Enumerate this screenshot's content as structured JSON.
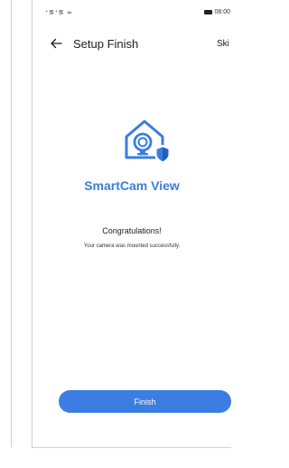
{
  "status_bar": {
    "signal": "⁺⪚⁺⪚ ≈",
    "time": "08:00"
  },
  "header": {
    "back_icon": "arrow-left-icon",
    "title": "Setup Finish",
    "skip_label": "Ski"
  },
  "brand": {
    "logo_icon": "home-camera-shield-icon",
    "name": "SmartCam View"
  },
  "message": {
    "headline": "Congratulations!",
    "detail": "Your camera was mounted successfully."
  },
  "actions": {
    "finish_label": "Finish"
  },
  "colors": {
    "accent": "#3b7de2",
    "brand_text": "#3a7de0"
  }
}
